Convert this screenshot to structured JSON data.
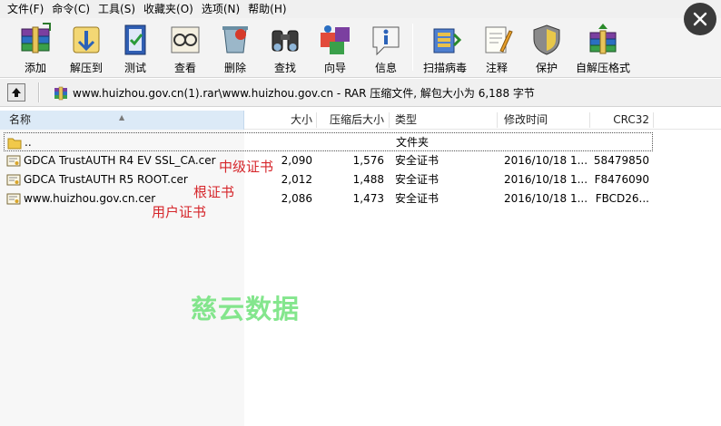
{
  "menu": [
    "文件(F)",
    "命令(C)",
    "工具(S)",
    "收藏夹(O)",
    "选项(N)",
    "帮助(H)"
  ],
  "toolbar": {
    "buttons": [
      {
        "label": "添加",
        "icon": "add-archive-icon"
      },
      {
        "label": "解压到",
        "icon": "extract-to-icon"
      },
      {
        "label": "测试",
        "icon": "test-icon"
      },
      {
        "label": "查看",
        "icon": "view-icon"
      },
      {
        "label": "删除",
        "icon": "delete-icon"
      },
      {
        "label": "查找",
        "icon": "find-icon"
      },
      {
        "label": "向导",
        "icon": "wizard-icon"
      },
      {
        "label": "信息",
        "icon": "info-icon"
      },
      {
        "label": "扫描病毒",
        "icon": "virus-scan-icon"
      },
      {
        "label": "注释",
        "icon": "comment-icon"
      },
      {
        "label": "保护",
        "icon": "protect-icon"
      },
      {
        "label": "自解压格式",
        "icon": "sfx-icon"
      }
    ]
  },
  "address": {
    "text": "www.huizhou.gov.cn(1).rar\\www.huizhou.gov.cn - RAR 压缩文件, 解包大小为 6,188 字节"
  },
  "columns": {
    "name": "名称",
    "size": "大小",
    "packed": "压缩后大小",
    "type": "类型",
    "modified": "修改时间",
    "crc": "CRC32"
  },
  "rows": [
    {
      "name": "..",
      "size": "",
      "packed": "",
      "type": "文件夹",
      "modified": "",
      "crc": "",
      "kind": "folder"
    },
    {
      "name": "GDCA TrustAUTH R4 EV SSL_CA.cer",
      "size": "2,090",
      "packed": "1,576",
      "type": "安全证书",
      "modified": "2016/10/18 1...",
      "crc": "58479850",
      "kind": "cert"
    },
    {
      "name": "GDCA TrustAUTH R5 ROOT.cer",
      "size": "2,012",
      "packed": "1,488",
      "type": "安全证书",
      "modified": "2016/10/18 1...",
      "crc": "F8476090",
      "kind": "cert"
    },
    {
      "name": "www.huizhou.gov.cn.cer",
      "size": "2,086",
      "packed": "1,473",
      "type": "安全证书",
      "modified": "2016/10/18 1...",
      "crc": "FBCD26...",
      "kind": "cert"
    }
  ],
  "annotations": {
    "intermediate": "中级证书",
    "root": "根证书",
    "user": "用户证书"
  },
  "watermark": "慈云数据",
  "colors": {
    "annotation": "#d6262b",
    "watermark": "#6fe27a",
    "header_selected": "#dceaf7"
  }
}
